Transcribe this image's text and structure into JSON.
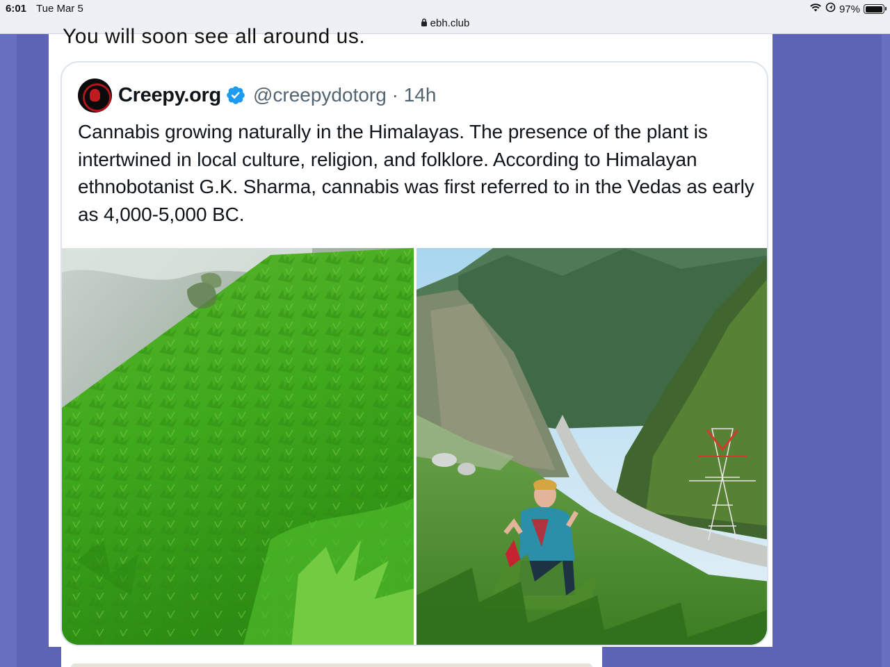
{
  "status_bar": {
    "time": "6:01",
    "date": "Tue Mar 5",
    "url": "ebh.club",
    "battery_percent": "97%",
    "battery_level": 0.97
  },
  "page": {
    "previous_text": "You will soon see all around us."
  },
  "tweet": {
    "display_name": "Creepy.org",
    "handle_time": "@creepydotorg · 14h",
    "verified": true,
    "text": "Cannabis growing naturally in the Himalayas. The presence of the plant is intertwined in local culture, religion, and folklore. According to Himalayan ethnobotanist G.K. Sharma, cannabis was first referred to in the Vedas as early as 4,000-5,000 BC.",
    "media": [
      {
        "icon": "photo-cannabis-hillside"
      },
      {
        "icon": "photo-woman-in-himalayan-valley"
      }
    ]
  },
  "colors": {
    "page_background": "#5d64b5",
    "verified_badge": "#1d9bf0",
    "handle": "#536471"
  }
}
